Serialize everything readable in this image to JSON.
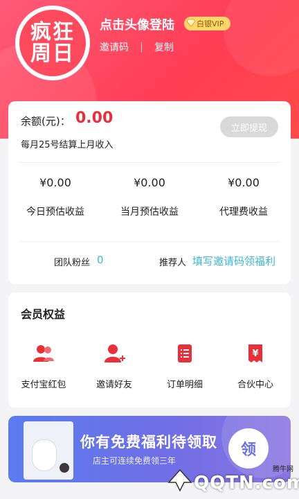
{
  "header": {
    "avatar_line1": "疯狂",
    "avatar_line2": "周日",
    "login_text": "点击头像登陆",
    "vip_label": "白银VIP",
    "invite_label": "邀请码",
    "copy_label": "复制"
  },
  "balance": {
    "label": "余额(元)：",
    "value": "0.00",
    "withdraw_label": "立即提现",
    "settle_note": "每月25号结算上月收入"
  },
  "stats": [
    {
      "value": "¥0.00",
      "label": "今日预估收益"
    },
    {
      "value": "¥0.00",
      "label": "当月预估收益"
    },
    {
      "value": "¥0.00",
      "label": "代理费收益"
    }
  ],
  "team": {
    "fans_label": "团队粉丝",
    "fans_value": "0",
    "referrer_label": "推荐人",
    "referrer_link": "填写邀请码领福利"
  },
  "member": {
    "title": "会员权益",
    "items": [
      {
        "label": "支付宝红包",
        "icon": "users-icon"
      },
      {
        "label": "邀请好友",
        "icon": "add-user-icon"
      },
      {
        "label": "订单明细",
        "icon": "list-icon"
      },
      {
        "label": "合伙中心",
        "icon": "yen-doc-icon"
      }
    ]
  },
  "banner": {
    "title": "你有免费福利待领取",
    "subtitle": "店主可连续免费领三年",
    "claim_label": "领"
  },
  "watermark": {
    "text": "QQTN.com",
    "small": "腾牛网"
  },
  "colors": {
    "header": "#ff4a5e",
    "accent_red": "#e8303a",
    "link_blue": "#3bb8d8",
    "banner": "#6f6ee6"
  }
}
